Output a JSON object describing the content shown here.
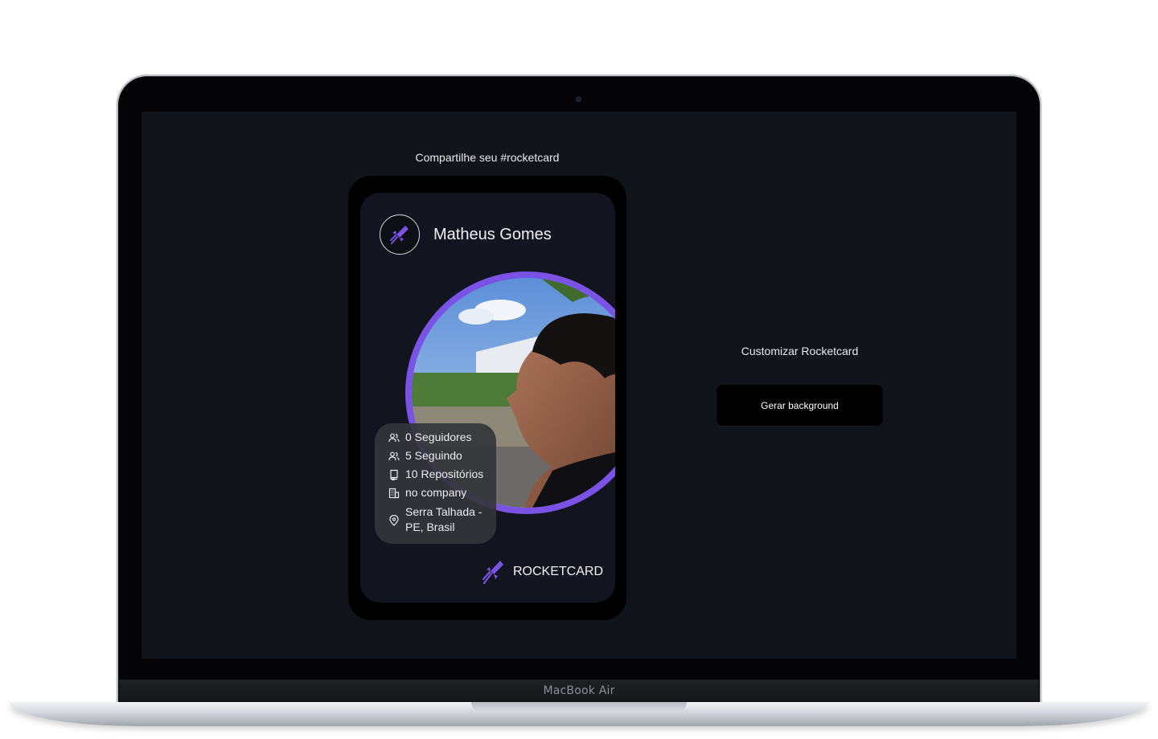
{
  "device": {
    "label": "MacBook Air"
  },
  "page": {
    "share_title": "Compartilhe seu #rocketcard",
    "customize_title": "Customizar Rocketcard",
    "generate_button": "Gerar background"
  },
  "card": {
    "name": "Matheus Gomes",
    "stats": {
      "followers": "0 Seguidores",
      "following": "5 Seguindo",
      "repositories": "10 Repositórios",
      "company": "no company",
      "location_line1": "Serra Talhada -",
      "location_line2": "PE, Brasil"
    },
    "brand": "ROCKETCARD"
  },
  "colors": {
    "accent": "#7a52e6",
    "screen_bg": "#12141c",
    "card_bg": "#121520"
  },
  "icons": [
    "rocket-icon",
    "users-icon",
    "repo-icon",
    "building-icon",
    "map-pin-icon"
  ]
}
